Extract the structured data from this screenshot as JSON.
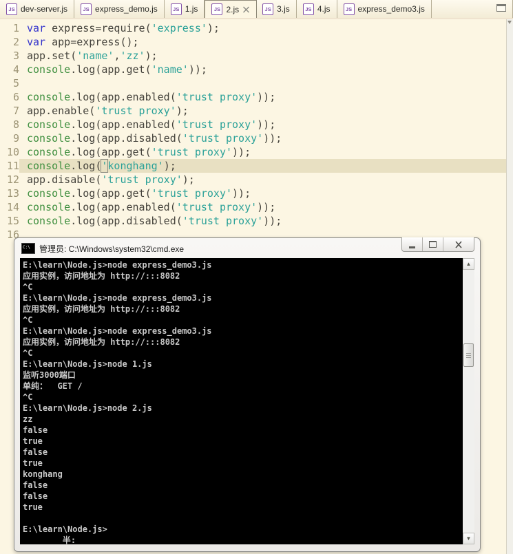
{
  "colors": {
    "editor_background": "#fcf6e3",
    "current_line_highlight": "#e8e0c2",
    "keyword": "#3333cc",
    "string": "#2aa198",
    "console_identifier_green": "#3f8f3f",
    "line_number": "#9c9374",
    "js_icon_purple": "#8250a8",
    "terminal_background": "#000000",
    "terminal_text": "#c8c8c8"
  },
  "editor": {
    "js_icon_text": "JS",
    "tabs": [
      {
        "label": "dev-server.js",
        "active": false
      },
      {
        "label": "express_demo.js",
        "active": false
      },
      {
        "label": "1.js",
        "active": false
      },
      {
        "label": "2.js",
        "active": true
      },
      {
        "label": "3.js",
        "active": false
      },
      {
        "label": "4.js",
        "active": false
      },
      {
        "label": "express_demo3.js",
        "active": false
      }
    ],
    "code": {
      "current_line": 11,
      "lines": [
        {
          "n": 1,
          "tokens": [
            [
              "k",
              "var"
            ],
            [
              "d",
              " express=require("
            ],
            [
              "s",
              "'express'"
            ],
            [
              "d",
              ");"
            ]
          ]
        },
        {
          "n": 2,
          "tokens": [
            [
              "k",
              "var"
            ],
            [
              "d",
              " app=express();"
            ]
          ]
        },
        {
          "n": 3,
          "tokens": [
            [
              "d",
              "app.set("
            ],
            [
              "s",
              "'name'"
            ],
            [
              "d",
              ","
            ],
            [
              "s",
              "'zz'"
            ],
            [
              "d",
              ");"
            ]
          ]
        },
        {
          "n": 4,
          "tokens": [
            [
              "g",
              "console"
            ],
            [
              "d",
              ".log(app.get("
            ],
            [
              "s",
              "'name'"
            ],
            [
              "d",
              "));"
            ]
          ]
        },
        {
          "n": 5,
          "tokens": []
        },
        {
          "n": 6,
          "tokens": [
            [
              "g",
              "console"
            ],
            [
              "d",
              ".log(app.enabled("
            ],
            [
              "s",
              "'trust proxy'"
            ],
            [
              "d",
              "));"
            ]
          ]
        },
        {
          "n": 7,
          "tokens": [
            [
              "d",
              "app.enable("
            ],
            [
              "s",
              "'trust proxy'"
            ],
            [
              "d",
              ");"
            ]
          ]
        },
        {
          "n": 8,
          "tokens": [
            [
              "g",
              "console"
            ],
            [
              "d",
              ".log(app.enabled("
            ],
            [
              "s",
              "'trust proxy'"
            ],
            [
              "d",
              "));"
            ]
          ]
        },
        {
          "n": 9,
          "tokens": [
            [
              "g",
              "console"
            ],
            [
              "d",
              ".log(app.disabled("
            ],
            [
              "s",
              "'trust proxy'"
            ],
            [
              "d",
              "));"
            ]
          ]
        },
        {
          "n": 10,
          "tokens": [
            [
              "g",
              "console"
            ],
            [
              "d",
              ".log(app.get("
            ],
            [
              "s",
              "'trust proxy'"
            ],
            [
              "d",
              "));"
            ]
          ]
        },
        {
          "n": 11,
          "tokens": [
            [
              "g",
              "console"
            ],
            [
              "d",
              ".log("
            ],
            [
              "sb",
              "'"
            ],
            [
              "s",
              "konghang'"
            ],
            [
              "d",
              ");"
            ]
          ]
        },
        {
          "n": 12,
          "tokens": [
            [
              "d",
              "app.disable("
            ],
            [
              "s",
              "'trust proxy'"
            ],
            [
              "d",
              ");"
            ]
          ]
        },
        {
          "n": 13,
          "tokens": [
            [
              "g",
              "console"
            ],
            [
              "d",
              ".log(app.get("
            ],
            [
              "s",
              "'trust proxy'"
            ],
            [
              "d",
              "));"
            ]
          ]
        },
        {
          "n": 14,
          "tokens": [
            [
              "g",
              "console"
            ],
            [
              "d",
              ".log(app.enabled("
            ],
            [
              "s",
              "'trust proxy'"
            ],
            [
              "d",
              "));"
            ]
          ]
        },
        {
          "n": 15,
          "tokens": [
            [
              "g",
              "console"
            ],
            [
              "d",
              ".log(app.disabled("
            ],
            [
              "s",
              "'trust proxy'"
            ],
            [
              "d",
              "));"
            ]
          ]
        },
        {
          "n": 16,
          "tokens": []
        }
      ]
    }
  },
  "cmd_window": {
    "title": "管理员: C:\\Windows\\system32\\cmd.exe",
    "icon_text": "C:\\",
    "console": {
      "lines": [
        "E:\\learn\\Node.js>node express_demo3.js",
        "应用实例，访问地址为 http://:::8082",
        "^C",
        "E:\\learn\\Node.js>node express_demo3.js",
        "应用实例，访问地址为 http://:::8082",
        "^C",
        "E:\\learn\\Node.js>node express_demo3.js",
        "应用实例，访问地址为 http://:::8082",
        "^C",
        "E:\\learn\\Node.js>node 1.js",
        "监听3000端口",
        "单纯：  GET /",
        "^C",
        "E:\\learn\\Node.js>node 2.js",
        "zz",
        "false",
        "true",
        "false",
        "true",
        "konghang",
        "false",
        "false",
        "true",
        "",
        "E:\\learn\\Node.js>"
      ],
      "ime_indicator": {
        "indent": "        ",
        "char": "半",
        "suffix": ":"
      }
    }
  }
}
